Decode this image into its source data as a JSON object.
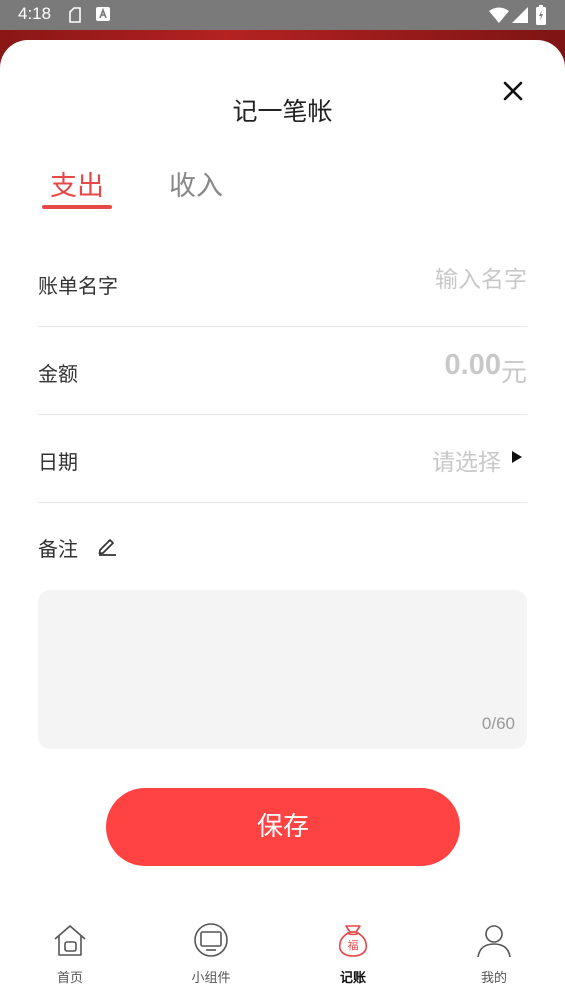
{
  "status_bar": {
    "time": "4:18",
    "icons": [
      "notification-icon",
      "keyboard-a-icon",
      "wifi-icon",
      "signal-icon",
      "battery-charging-icon"
    ]
  },
  "sheet": {
    "title": "记一笔帐",
    "close_icon": "close-icon"
  },
  "tabs": [
    {
      "label": "支出",
      "active": true
    },
    {
      "label": "收入",
      "active": false
    }
  ],
  "form": {
    "name": {
      "label": "账单名字",
      "placeholder": "输入名字",
      "value": ""
    },
    "amount": {
      "label": "金额",
      "value": "0.00",
      "unit": "元"
    },
    "date": {
      "label": "日期",
      "placeholder": "请选择"
    },
    "note": {
      "label": "备注",
      "placeholder": "",
      "value": "",
      "counter": "0/60"
    }
  },
  "save_label": "保存",
  "bottom_nav": [
    {
      "label": "首页",
      "icon": "home-icon",
      "active": false
    },
    {
      "label": "小组件",
      "icon": "widget-icon",
      "active": false
    },
    {
      "label": "记账",
      "icon": "fortune-bag-icon",
      "active": true
    },
    {
      "label": "我的",
      "icon": "user-icon",
      "active": false
    }
  ],
  "colors": {
    "accent": "#ff4343",
    "tab_active": "#e64848",
    "text": "#333333",
    "placeholder": "#c8c8c8",
    "status_bar": "#7a7a7a"
  }
}
